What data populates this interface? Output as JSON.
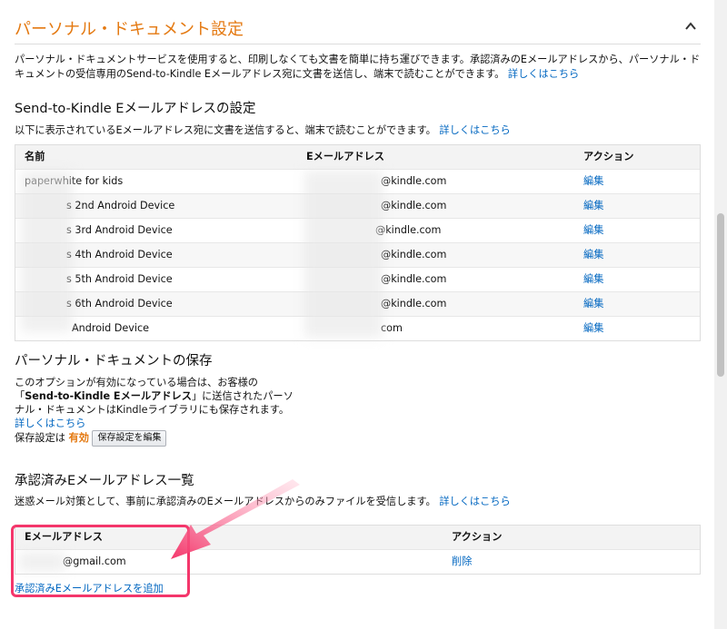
{
  "section": {
    "title": "パーソナル・ドキュメント設定",
    "description": "パーソナル・ドキュメントサービスを使用すると、印刷しなくても文書を簡単に持ち運びできます。承認済みのEメールアドレスから、パーソナル・ドキュメントの受信専用のSend-to-Kindle Eメールアドレス宛に文書を送信し、端末で読むことができます。",
    "learn_more": "詳しくはこちら"
  },
  "send_to_kindle": {
    "heading": "Send-to-Kindle Eメールアドレスの設定",
    "description": "以下に表示されているEメールアドレス宛に文書を送信すると、端末で読むことができます。",
    "learn_more": "詳しくはこちら",
    "columns": [
      "名前",
      "Eメールアドレス",
      "アクション"
    ],
    "rows": [
      {
        "name": "paperwhite for kids",
        "email": "@kindle.com",
        "action": "編集"
      },
      {
        "name": "s 2nd Android Device",
        "email": "@kindle.com",
        "action": "編集"
      },
      {
        "name": "s 3rd Android Device",
        "email": "@kindle.com",
        "action": "編集"
      },
      {
        "name": "s 4th Android Device",
        "email": "@kindle.com",
        "action": "編集"
      },
      {
        "name": "s 5th Android Device",
        "email": "@kindle.com",
        "action": "編集"
      },
      {
        "name": "s 6th Android Device",
        "email": "@kindle.com",
        "action": "編集"
      },
      {
        "name": "Android Device",
        "email": "com",
        "action": "編集"
      }
    ]
  },
  "save": {
    "heading": "パーソナル・ドキュメントの保存",
    "text_before": "このオプションが有効になっている場合は、お客様の「",
    "text_bold": "Send-to-Kindle Eメールアドレス",
    "text_after": "」に送信されたパーソナル・ドキュメントはKindleライブラリにも保存されます。",
    "learn_more": "詳しくはこちら",
    "status_label": "保存設定は",
    "status_value": "有効",
    "edit_button": "保存設定を編集"
  },
  "approved": {
    "heading": "承認済みEメールアドレス一覧",
    "description": "迷惑メール対策として、事前に承認済みのEメールアドレスからのみファイルを受信します。",
    "learn_more": "詳しくはこちら",
    "columns": [
      "Eメールアドレス",
      "アクション"
    ],
    "rows": [
      {
        "email": "@gmail.com",
        "action": "削除"
      }
    ],
    "add_link": "承認済みEメールアドレスを追加"
  },
  "colors": {
    "accent": "#e47911",
    "link": "#0066c0",
    "highlight": "#f4366b"
  }
}
